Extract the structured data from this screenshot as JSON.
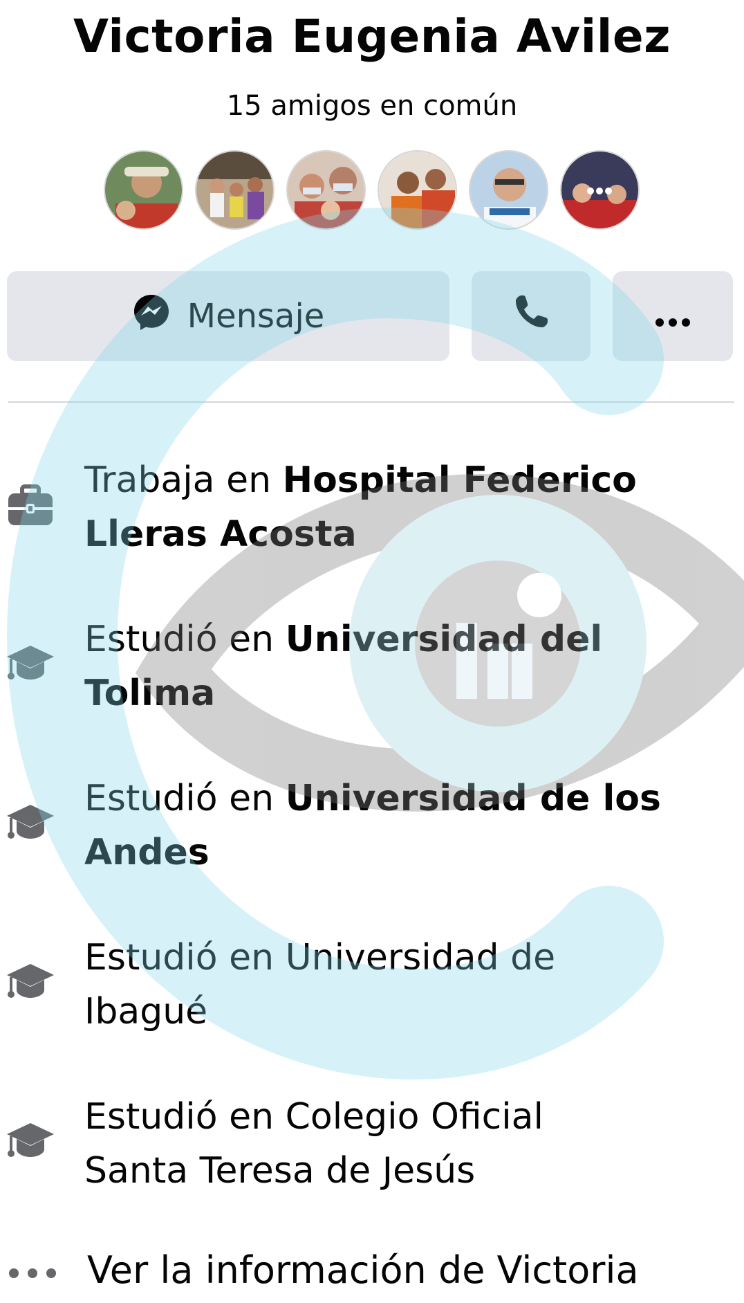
{
  "profile": {
    "name": "Victoria Eugenia Avilez",
    "mutual_friends": "15 amigos en común",
    "avatars": [
      {
        "name": "mutual-friend-avatar-1",
        "color": "#7a8f6a"
      },
      {
        "name": "mutual-friend-avatar-2",
        "color": "#8a6e5a"
      },
      {
        "name": "mutual-friend-avatar-3",
        "color": "#b08a7a"
      },
      {
        "name": "mutual-friend-avatar-4",
        "color": "#c8703a"
      },
      {
        "name": "mutual-friend-avatar-5",
        "color": "#9fb6cc"
      },
      {
        "name": "mutual-friend-avatar-6",
        "color": "#a8303a"
      }
    ]
  },
  "actions": {
    "message_label": "Mensaje",
    "message_icon": "messenger-icon",
    "call_icon": "phone-icon",
    "more_icon": "more-horizontal-icon"
  },
  "info": [
    {
      "icon": "briefcase-icon",
      "prefix": "Trabaja en ",
      "line1_bold": "Hospital Federico",
      "line2_bold": "Lleras Acosta"
    },
    {
      "icon": "graduation-cap-icon",
      "prefix": "Estudió en ",
      "line1_bold": "Universidad del",
      "line2_bold": "Tolima"
    },
    {
      "icon": "graduation-cap-icon",
      "prefix": "Estudió en ",
      "line1_bold": "Universidad de los",
      "line2_bold": "Andes"
    },
    {
      "icon": "graduation-cap-icon",
      "prefix": "Estudió en ",
      "line1": "Universidad de",
      "line2": "Ibagué"
    },
    {
      "icon": "graduation-cap-icon",
      "prefix": "Estudió en ",
      "line1": "Colegio Oficial",
      "line2": "Santa Teresa de Jesús"
    }
  ],
  "see_more": {
    "label": "Ver la información de Victoria",
    "icon": "more-horizontal-icon"
  },
  "colors": {
    "button_bg": "#e4e6eb",
    "icon_gray": "#65676b",
    "watermark_cyan": "#7fd6ea",
    "watermark_gray": "#8a8a8a"
  }
}
